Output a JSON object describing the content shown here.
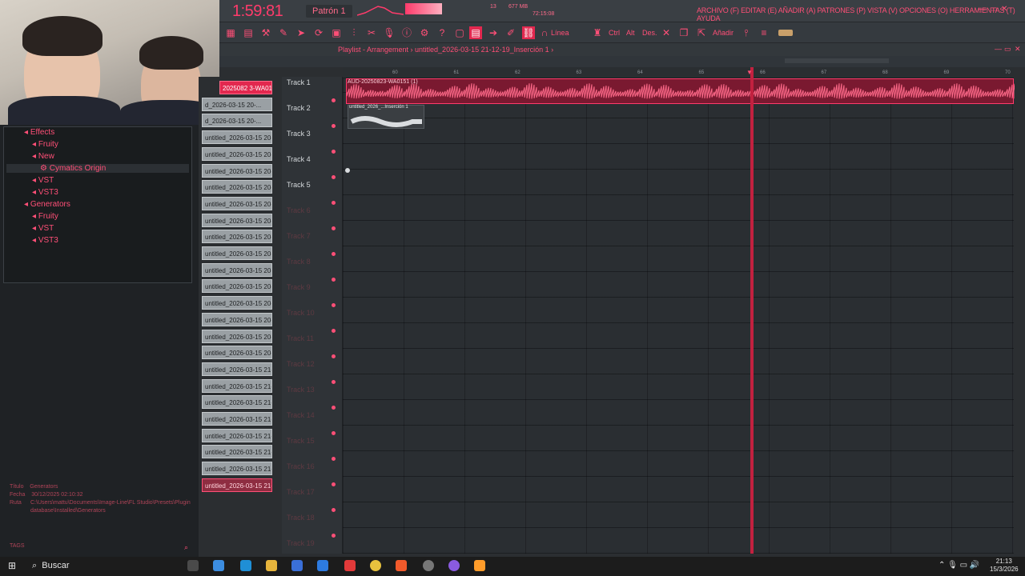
{
  "transport": {
    "time": "1:59:81",
    "pattern": "Patrón 1",
    "memory": "677 MB",
    "clock2": "72:15:08",
    "counter": "13"
  },
  "menu": {
    "text": "ARCHIVO (F) EDITAR (E) AÑADIR (A) PATRONES (P) VISTA (V) OPCIONES (O) HERRAMIENTAS (T) AYUDA"
  },
  "toolbar": {
    "mode_label": "Línea",
    "ctrl": "Ctrl",
    "alt": "Alt",
    "des": "Des.",
    "add": "Añadir"
  },
  "browser": {
    "items": [
      {
        "label": "Effects",
        "level": 1,
        "icon": "folder-icon"
      },
      {
        "label": "Fruity",
        "level": 2,
        "icon": "folder-icon"
      },
      {
        "label": "New",
        "level": 2,
        "icon": "folder-icon"
      },
      {
        "label": "Cymatics Origin",
        "level": 3,
        "icon": "gear-icon"
      },
      {
        "label": "VST",
        "level": 2,
        "icon": "folder-icon"
      },
      {
        "label": "VST3",
        "level": 2,
        "icon": "folder-icon"
      },
      {
        "label": "Generators",
        "level": 1,
        "icon": "folder-icon"
      },
      {
        "label": "Fruity",
        "level": 2,
        "icon": "folder-icon"
      },
      {
        "label": "VST",
        "level": 2,
        "icon": "folder-icon"
      },
      {
        "label": "VST3",
        "level": 2,
        "icon": "folder-icon"
      }
    ],
    "meta": {
      "title_label": "Título",
      "title_value": "Generators",
      "date_label": "Fecha",
      "date_value": "30/12/2025 02:10:32",
      "path_label": "Ruta",
      "path_value": "C:\\Users\\mattu\\Documents\\Image-Line\\FL Studio\\Presets\\Plugin database\\Installed\\Generators"
    },
    "tags": "TAGS"
  },
  "clips": [
    "2025082 3-WA01...",
    "d_2026-03-15 20-...",
    "d_2026-03-15 20-...",
    "untitled_2026-03-15 20-...",
    "untitled_2026-03-15 20-...",
    "untitled_2026-03-15 20-...",
    "untitled_2026-03-15 20-...",
    "untitled_2026-03-15 20-...",
    "untitled_2026-03-15 20-...",
    "untitled_2026-03-15 20-...",
    "untitled_2026-03-15 20-...",
    "untitled_2026-03-15 20-...",
    "untitled_2026-03-15 20-...",
    "untitled_2026-03-15 20-...",
    "untitled_2026-03-15 20-...",
    "untitled_2026-03-15 20-...",
    "untitled_2026-03-15 20-...",
    "untitled_2026-03-15 21-...",
    "untitled_2026-03-15 21-...",
    "untitled_2026-03-15 21-...",
    "untitled_2026-03-15 21-...",
    "untitled_2026-03-15 21-...",
    "untitled_2026-03-15 21-...",
    "untitled_2026-03-15 21-...",
    "untitled_2026-03-15 21-..."
  ],
  "playlist": {
    "title": "Playlist - Arrangement › untitled_2026-03-15 21-12-19_Inserción 1 ›",
    "tracks": [
      "Track 1",
      "Track 2",
      "Track 3",
      "Track 4",
      "Track 5",
      "Track 6",
      "Track 7",
      "Track 8",
      "Track 9",
      "Track 10",
      "Track 11",
      "Track 12",
      "Track 13",
      "Track 14",
      "Track 15",
      "Track 16",
      "Track 17",
      "Track 18",
      "Track 19"
    ],
    "ruler": [
      "60",
      "61",
      "62",
      "63",
      "64",
      "65",
      "66",
      "67",
      "68",
      "69",
      "70"
    ],
    "audio_clip_label": "AUD-20250823-WA0151 (1)",
    "small_clip_label": "untitled_2026_...Inserción 1"
  },
  "taskbar": {
    "search": "Buscar",
    "time": "21:13",
    "date": "15/3/2026"
  },
  "colors": {
    "accent": "#ff4f77",
    "bg": "#2a2e32"
  }
}
